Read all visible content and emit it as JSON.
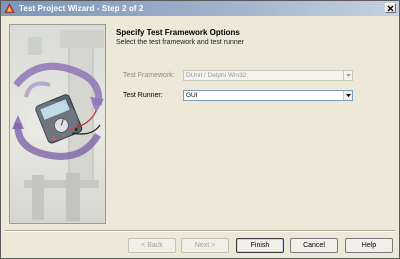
{
  "window": {
    "title": "Test Project Wizard - Step 2 of 2",
    "close_icon": "close-icon"
  },
  "header": {
    "title": "Specify Test Framework Options",
    "subtitle": "Select the test framework and test runner"
  },
  "form": {
    "framework_label": "Test Framework:",
    "framework_value": "DUnit / Delphi Win32",
    "framework_enabled": false,
    "runner_label": "Test Runner:",
    "runner_value": "GUI",
    "runner_enabled": true
  },
  "buttons": {
    "back": "< Back",
    "next": "Next >",
    "finish": "Finish",
    "cancel": "Cancel",
    "help": "Help"
  },
  "colors": {
    "titlebar_start": "#7d96b7",
    "dialog_bg": "#ece9d8",
    "arrow_purple": "#8a6cb0"
  }
}
